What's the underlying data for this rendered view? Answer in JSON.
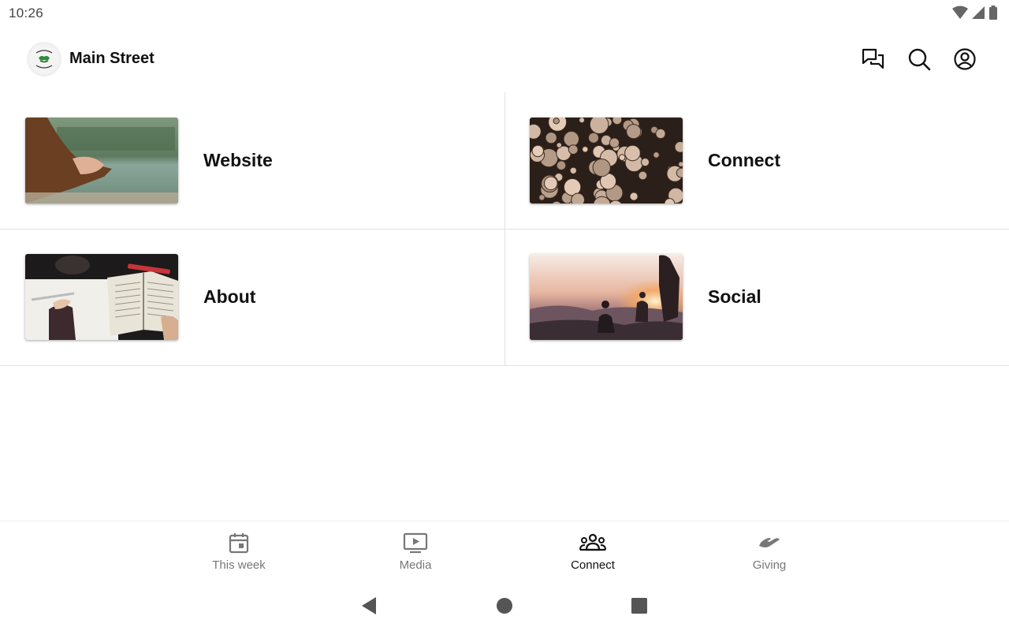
{
  "status_bar": {
    "time": "10:26",
    "icons": [
      "wifi-icon",
      "signal-icon",
      "battery-icon"
    ]
  },
  "app_bar": {
    "title": "Main Street",
    "actions": [
      "chat-icon",
      "search-icon",
      "account-icon"
    ]
  },
  "tiles": [
    {
      "label": "Website",
      "image": "hands-by-lake-photo"
    },
    {
      "label": "Connect",
      "image": "stacked-logs-photo"
    },
    {
      "label": "About",
      "image": "bible-and-journal-photo"
    },
    {
      "label": "Social",
      "image": "sunset-hikers-photo"
    }
  ],
  "bottom_nav": {
    "items": [
      {
        "label": "This week",
        "icon": "calendar-icon",
        "active": false
      },
      {
        "label": "Media",
        "icon": "play-screen-icon",
        "active": false
      },
      {
        "label": "Connect",
        "icon": "group-icon",
        "active": true
      },
      {
        "label": "Giving",
        "icon": "giving-hand-icon",
        "active": false
      }
    ]
  },
  "system_nav": [
    "back-icon",
    "home-icon",
    "recents-icon"
  ],
  "colors": {
    "text": "#111111",
    "muted": "#777777",
    "divider": "#e2e2e2",
    "logo_green": "#2e8b3a"
  }
}
